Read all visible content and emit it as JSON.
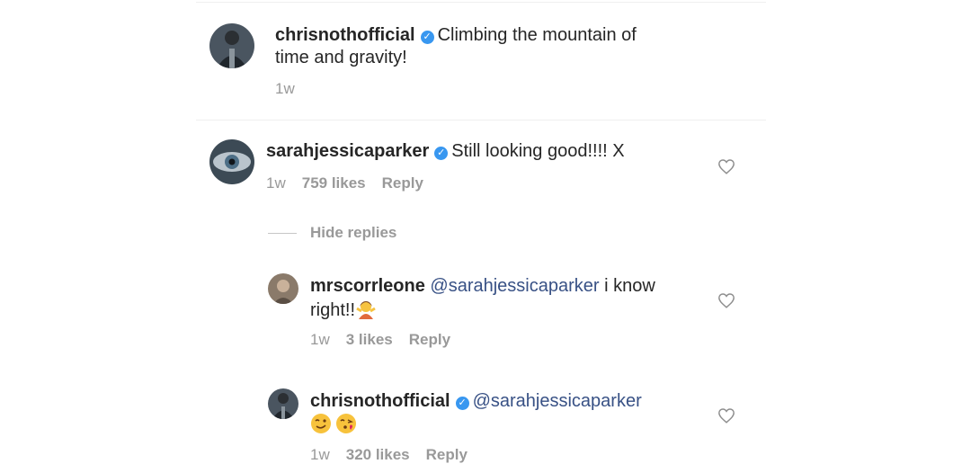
{
  "caption": {
    "username": "chrisnothofficial",
    "text_line1": "Climbing the mountain of",
    "text_line2": "time and gravity!",
    "time": "1w"
  },
  "comments": [
    {
      "username": "sarahjessicaparker",
      "text": "Still looking good!!!! X",
      "time": "1w",
      "likes": "759 likes",
      "reply": "Reply"
    }
  ],
  "hide_replies": "Hide replies",
  "replies": [
    {
      "username": "mrscorrleone",
      "mention": "@sarahjessicaparker",
      "text_after": " i know",
      "line2": "right!!",
      "emoji": "woman-gesturing-emoji",
      "time": "1w",
      "likes": "3 likes",
      "reply": "Reply"
    },
    {
      "username": "chrisnothofficial",
      "mention": "@sarahjessicaparker",
      "emojis": [
        "winking-face-emoji",
        "face-blowing-kiss-emoji"
      ],
      "time": "1w",
      "likes": "320 likes",
      "reply": "Reply"
    }
  ],
  "colors": {
    "verified": "#3897f0",
    "mention": "#385185",
    "muted": "#999999"
  },
  "icons": [
    "verified-badge-icon",
    "heart-icon"
  ]
}
